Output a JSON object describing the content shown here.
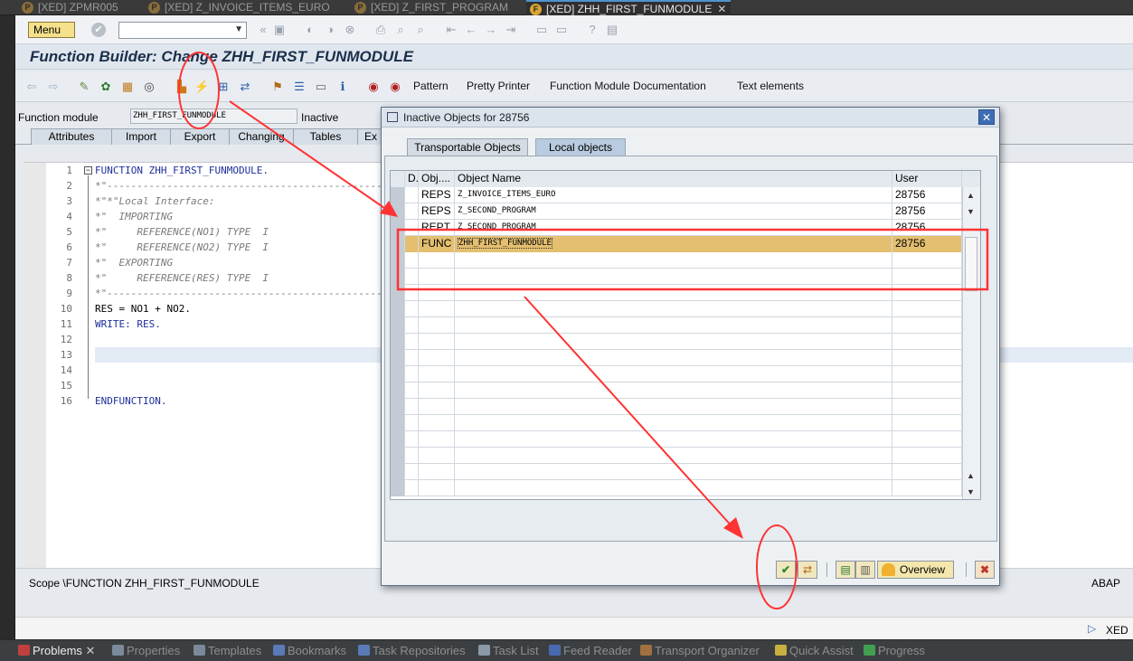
{
  "editor_tabs": [
    {
      "label": "[XED] ZPMR005"
    },
    {
      "label": "[XED] Z_INVOICE_ITEMS_EURO"
    },
    {
      "label": "[XED] Z_FIRST_PROGRAM"
    },
    {
      "label": "[XED] ZHH_FIRST_FUNMODULE"
    }
  ],
  "sap": {
    "menu_label": "Menu",
    "title": "Function Builder: Change ZHH_FIRST_FUNMODULE",
    "toolbar_texts": [
      "Pattern",
      "Pretty Printer",
      "Function Module Documentation",
      "Text elements"
    ],
    "function_module_label": "Function module",
    "function_module_value": "ZHH_FIRST_FUNMODULE",
    "status": "Inactive",
    "subtabs": [
      "Attributes",
      "Import",
      "Export",
      "Changing",
      "Tables",
      "Ex"
    ],
    "scope": "Scope \\FUNCTION ZHH_FIRST_FUNMODULE",
    "language": "ABAP",
    "status_right": "XED ("
  },
  "code": {
    "line_numbers": [
      "1",
      "2",
      "3",
      "4",
      "5",
      "6",
      "7",
      "8",
      "9",
      "10",
      "11",
      "12",
      "13",
      "14",
      "15",
      "16"
    ],
    "lines": [
      "FUNCTION ZHH_FIRST_FUNMODULE.",
      "*\"----------------------------------------------------------------------",
      "*\"*\"Local Interface:",
      "*\"  IMPORTING",
      "*\"     REFERENCE(NO1) TYPE  I",
      "*\"     REFERENCE(NO2) TYPE  I",
      "*\"  EXPORTING",
      "*\"     REFERENCE(RES) TYPE  I",
      "*\"----------------------------------------------------------------------",
      "RES = NO1 + NO2.",
      "WRITE: RES.",
      "",
      "",
      "",
      "",
      "ENDFUNCTION."
    ]
  },
  "dialog": {
    "title": "Inactive Objects for 28756",
    "tabs": [
      "Transportable Objects",
      "Local objects"
    ],
    "active_tab": "Local objects",
    "columns": [
      "D.",
      "Obj....",
      "Object Name",
      "User"
    ],
    "rows": [
      {
        "obj": "REPS",
        "name": "Z_INVOICE_ITEMS_EURO",
        "user": "28756"
      },
      {
        "obj": "REPS",
        "name": "Z_SECOND_PROGRAM",
        "user": "28756"
      },
      {
        "obj": "REPT",
        "name": "Z_SECOND_PROGRAM",
        "user": "28756"
      },
      {
        "obj": "FUNC",
        "name": "ZHH_FIRST_FUNMODULE",
        "user": "28756"
      }
    ],
    "selected_row": 3,
    "overview_label": "Overview"
  },
  "views": [
    "Problems",
    "Properties",
    "Templates",
    "Bookmarks",
    "Task Repositories",
    "Task List",
    "Feed Reader",
    "Transport Organizer",
    "Quick Assist",
    "Progress"
  ],
  "annotation_color": "#ff3333"
}
